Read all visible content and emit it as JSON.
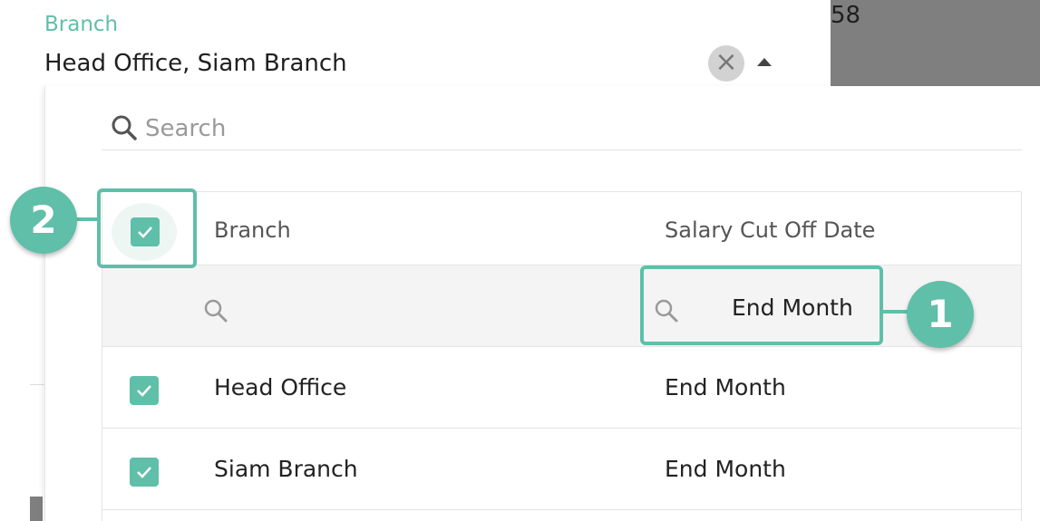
{
  "field": {
    "label": "Branch",
    "value": "Head Office, Siam Branch",
    "clear_glyph": "×"
  },
  "background": {
    "partial_number": "58"
  },
  "dropdown": {
    "search_placeholder": "Search",
    "columns": [
      "Branch",
      "Salary Cut Off Date"
    ],
    "select_all_checked": true,
    "filters": {
      "branch": "",
      "salary_cut_off_date": "End Month"
    },
    "rows": [
      {
        "branch": "Head Office",
        "salary_cut_off_date": "End Month",
        "checked": true
      },
      {
        "branch": "Siam Branch",
        "salary_cut_off_date": "End Month",
        "checked": true
      }
    ]
  },
  "callouts": {
    "marker_1": "1",
    "marker_2": "2"
  },
  "colors": {
    "accent": "#5fbfa9",
    "filter_row_bg": "#f4f4f4",
    "overlay_gray": "#7f7f7f"
  },
  "icons": [
    "search-icon",
    "close-icon",
    "caret-up-icon",
    "checkbox-checked-icon"
  ]
}
